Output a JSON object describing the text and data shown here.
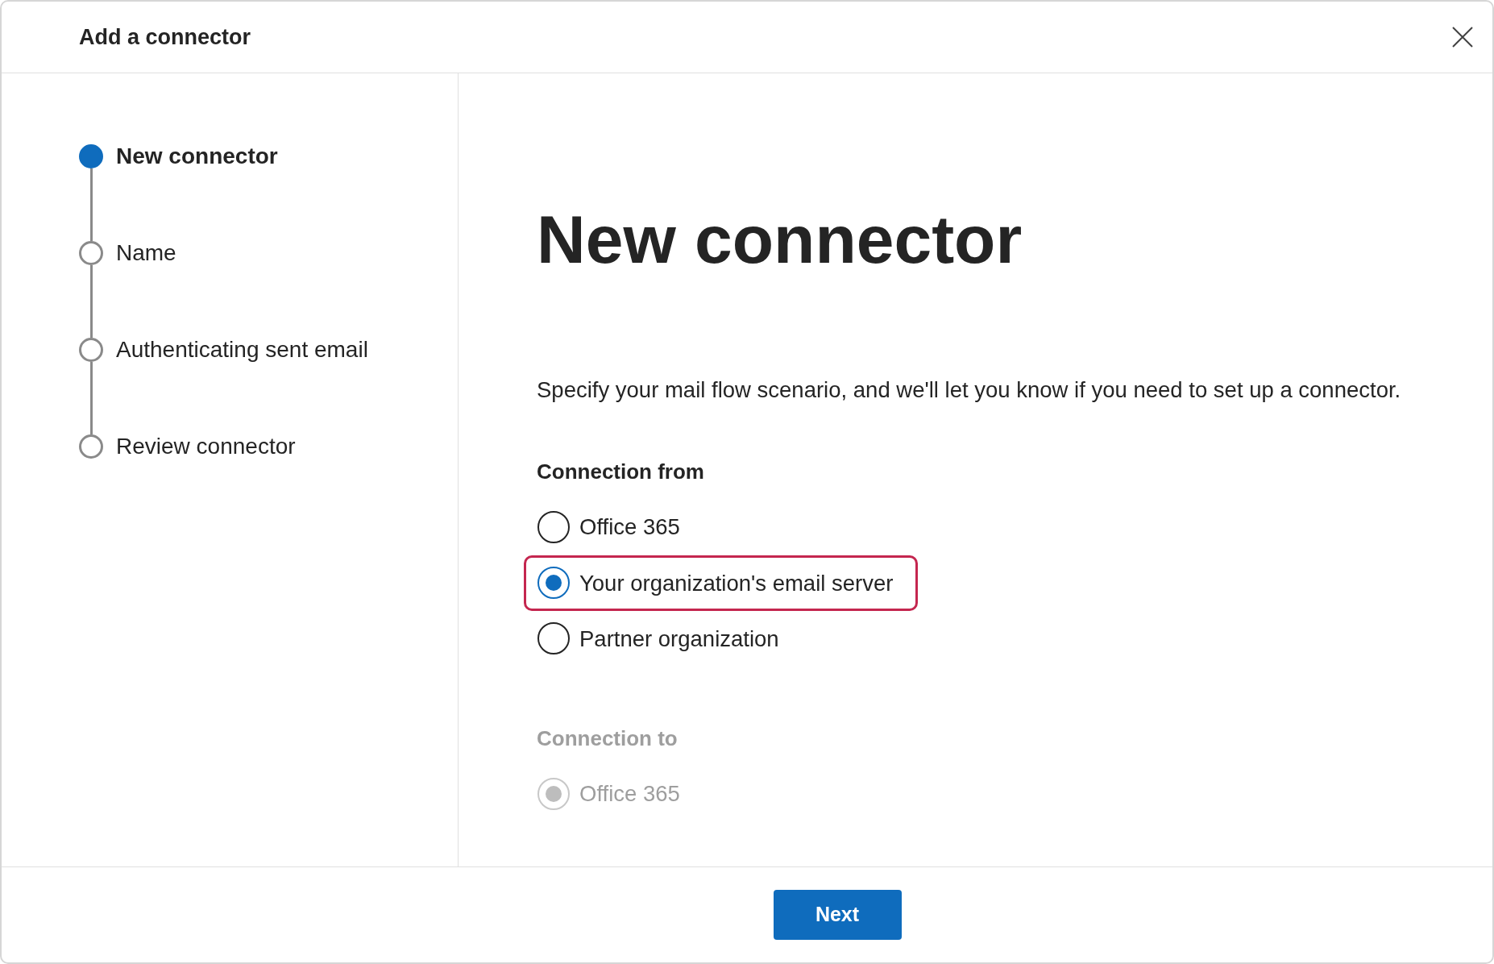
{
  "dialog": {
    "title": "Add a connector"
  },
  "steps": [
    {
      "label": "New connector",
      "selected": true
    },
    {
      "label": "Name",
      "selected": false
    },
    {
      "label": "Authenticating sent email",
      "selected": false
    },
    {
      "label": "Review connector",
      "selected": false
    }
  ],
  "heading": "New connector",
  "description": "Specify your mail flow scenario, and we'll let you know if you need to set up a connector.",
  "groups": [
    {
      "heading": "Connection from",
      "disabled": false,
      "options": [
        {
          "label": "Office 365",
          "selected": false,
          "highlighted": false
        },
        {
          "label": "Your organization's email server",
          "selected": true,
          "highlighted": true
        },
        {
          "label": "Partner organization",
          "selected": false,
          "highlighted": false
        }
      ]
    },
    {
      "heading": "Connection to",
      "disabled": true,
      "options": [
        {
          "label": "Office 365",
          "selected": true,
          "highlighted": false
        }
      ]
    }
  ],
  "footer": {
    "next_button": "Next"
  }
}
